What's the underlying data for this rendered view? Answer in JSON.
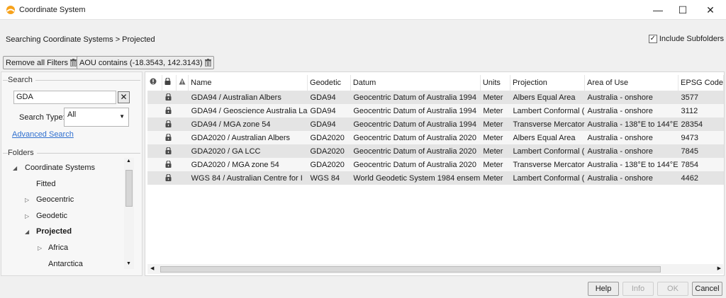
{
  "window": {
    "title": "Coordinate System",
    "icon": "app-logo-icon",
    "minimize_glyph": "—",
    "maximize_glyph": "☐",
    "close_glyph": "✕"
  },
  "breadcrumb": "Searching Coordinate Systems >  Projected",
  "include_subfolders": {
    "label": "Include Subfolders",
    "checked": true,
    "check_glyph": "✓"
  },
  "filters": [
    {
      "label": "Remove all Filters"
    },
    {
      "label": "AOU contains (-18.3543, 142.3143)"
    }
  ],
  "search": {
    "section_label": "Search",
    "value": "GDA",
    "clear_glyph": "✕",
    "type_label": "Search Type:",
    "type_value": "All",
    "advanced_link": "Advanced Search"
  },
  "folders": {
    "section_label": "Folders",
    "items": [
      {
        "label": "Coordinate Systems",
        "arrow": "◢"
      },
      {
        "label": "Fitted",
        "arrow": ""
      },
      {
        "label": "Geocentric",
        "arrow": "▷"
      },
      {
        "label": "Geodetic",
        "arrow": "▷"
      },
      {
        "label": "Projected",
        "arrow": "◢"
      },
      {
        "label": "Africa",
        "arrow": "▷"
      },
      {
        "label": "Antarctica",
        "arrow": ""
      }
    ]
  },
  "table": {
    "columns": [
      "Name",
      "Geodetic",
      "Datum",
      "Units",
      "Projection",
      "Area of Use",
      "EPSG Code"
    ],
    "rows": [
      [
        "GDA94 / Australian Albers",
        "GDA94",
        "Geocentric Datum of Australia 1994",
        "Meter",
        "Albers Equal Area",
        "Australia - onshore",
        "3577"
      ],
      [
        "GDA94 / Geoscience Australia La",
        "GDA94",
        "Geocentric Datum of Australia 1994",
        "Meter",
        "Lambert Conformal (",
        "Australia - onshore",
        "3112"
      ],
      [
        "GDA94 / MGA zone 54",
        "GDA94",
        "Geocentric Datum of Australia 1994",
        "Meter",
        "Transverse Mercator",
        "Australia - 138°E to 144°E",
        "28354"
      ],
      [
        "GDA2020 / Australian Albers",
        "GDA2020",
        "Geocentric Datum of Australia 2020",
        "Meter",
        "Albers Equal Area",
        "Australia - onshore",
        "9473"
      ],
      [
        "GDA2020 / GA LCC",
        "GDA2020",
        "Geocentric Datum of Australia 2020",
        "Meter",
        "Lambert Conformal (",
        "Australia - onshore",
        "7845"
      ],
      [
        "GDA2020 / MGA zone 54",
        "GDA2020",
        "Geocentric Datum of Australia 2020",
        "Meter",
        "Transverse Mercator",
        "Australia - 138°E to 144°E",
        "7854"
      ],
      [
        "WGS 84 / Australian Centre for I",
        "WGS 84",
        "World Geodetic System 1984 ensem",
        "Meter",
        "Lambert Conformal (",
        "Australia - onshore",
        "4462"
      ]
    ]
  },
  "footer": {
    "help": "Help",
    "info": "Info",
    "ok": "OK",
    "cancel": "Cancel"
  }
}
